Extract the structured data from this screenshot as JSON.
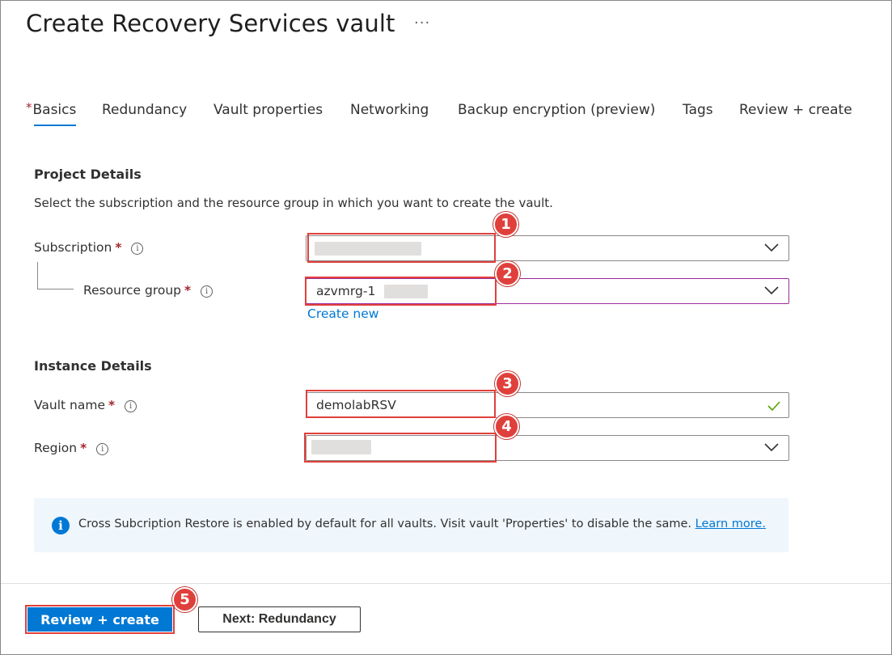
{
  "header": {
    "title": "Create Recovery Services vault",
    "more_label": "···"
  },
  "tabs": [
    {
      "label": "Basics",
      "required_marker": "*",
      "active": true
    },
    {
      "label": "Redundancy"
    },
    {
      "label": "Vault properties"
    },
    {
      "label": "Networking"
    },
    {
      "label": "Backup encryption (preview)"
    },
    {
      "label": "Tags"
    },
    {
      "label": "Review + create"
    }
  ],
  "project_details": {
    "heading": "Project Details",
    "description": "Select the subscription and the resource group in which you want to create the vault.",
    "subscription": {
      "label": "Subscription",
      "required": "*",
      "value": ""
    },
    "resource_group": {
      "label": "Resource group",
      "required": "*",
      "value": "azvmrg-1",
      "create_new_label": "Create new"
    }
  },
  "instance_details": {
    "heading": "Instance Details",
    "vault_name": {
      "label": "Vault name",
      "required": "*",
      "value": "demolabRSV"
    },
    "region": {
      "label": "Region",
      "required": "*",
      "value": ""
    }
  },
  "info_banner": {
    "message": "Cross Subcription Restore is enabled by default for all vaults. Visit vault 'Properties' to disable the same.",
    "link_label": "Learn more."
  },
  "info_icon_glyph": "i",
  "annotations": [
    "1",
    "2",
    "3",
    "4",
    "5"
  ],
  "footer": {
    "review_create_label": "Review + create",
    "next_label": "Next: Redundancy"
  },
  "colors": {
    "accent": "#0078d4",
    "highlight": "#e0403c",
    "required": "#a4262c",
    "valid": "#57a300"
  }
}
